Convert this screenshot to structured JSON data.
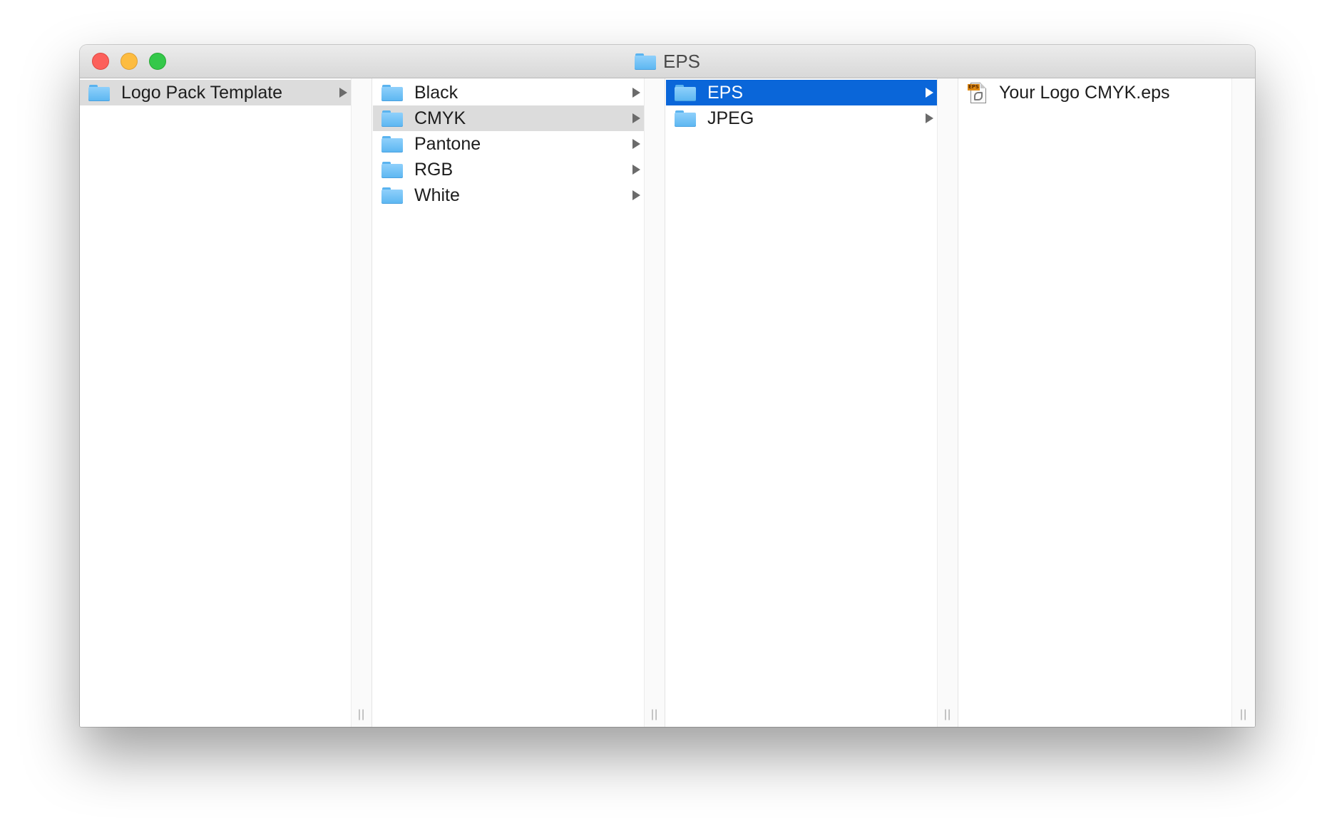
{
  "window": {
    "title": "EPS",
    "title_icon": "folder-icon"
  },
  "columns": [
    {
      "items": [
        {
          "label": "Logo Pack Template",
          "icon": "folder-icon",
          "has_children": true,
          "state": "selected-inactive"
        }
      ]
    },
    {
      "items": [
        {
          "label": "Black",
          "icon": "folder-icon",
          "has_children": true,
          "state": "normal"
        },
        {
          "label": "CMYK",
          "icon": "folder-icon",
          "has_children": true,
          "state": "selected-inactive"
        },
        {
          "label": "Pantone",
          "icon": "folder-icon",
          "has_children": true,
          "state": "normal"
        },
        {
          "label": "RGB",
          "icon": "folder-icon",
          "has_children": true,
          "state": "normal"
        },
        {
          "label": "White",
          "icon": "folder-icon",
          "has_children": true,
          "state": "normal"
        }
      ]
    },
    {
      "items": [
        {
          "label": "EPS",
          "icon": "folder-icon",
          "has_children": true,
          "state": "selected-active"
        },
        {
          "label": "JPEG",
          "icon": "folder-icon",
          "has_children": true,
          "state": "normal"
        }
      ]
    },
    {
      "items": [
        {
          "label": "Your Logo CMYK.eps",
          "icon": "eps-file-icon",
          "badge": "EPS",
          "has_children": false,
          "state": "normal"
        }
      ]
    }
  ],
  "resize_handle_glyph": "||",
  "colors": {
    "selection_active": "#0a66d9",
    "selection_inactive": "#dcdcdc",
    "folder": "#5bb6f1",
    "close": "#fc605b",
    "minimize": "#fdbc40",
    "zoom": "#34c84a"
  }
}
